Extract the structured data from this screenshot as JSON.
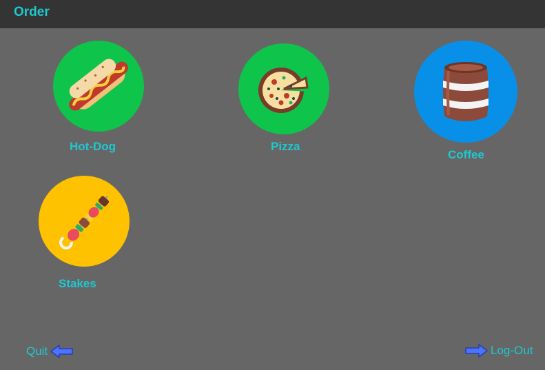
{
  "header": {
    "title": "Order"
  },
  "menu": {
    "hotdog": {
      "label": "Hot-Dog",
      "color": "#0ec44a",
      "icon": "hot-dog-icon"
    },
    "pizza": {
      "label": "Pizza",
      "color": "#0ec44a",
      "icon": "pizza-icon"
    },
    "coffee": {
      "label": "Coffee",
      "color": "#0890e8",
      "icon": "coffee-barrel-icon"
    },
    "stakes": {
      "label": "Stakes",
      "color": "#ffc200",
      "icon": "skewer-icon"
    }
  },
  "footer": {
    "quit_label": "Quit",
    "logout_label": "Log-Out",
    "arrow_color": "#4a74ff"
  }
}
